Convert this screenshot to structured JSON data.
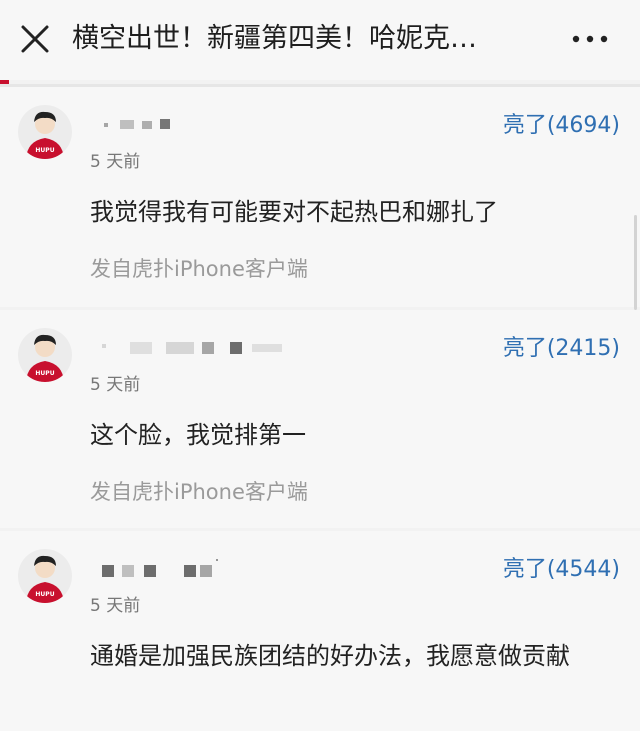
{
  "header": {
    "title": "横空出世！新疆第四美！哈妮克…",
    "close_icon": "close-icon",
    "more_icon": "more-icon",
    "accent_color": "#c8102e"
  },
  "comments": [
    {
      "avatar_text": "HUPU",
      "lights": "亮了(4694)",
      "time": "5 天前",
      "content": "我觉得我有可能要对不起热巴和娜扎了",
      "source": "发自虎扑iPhone客户端"
    },
    {
      "avatar_text": "HUPU",
      "lights": "亮了(2415)",
      "time": "5 天前",
      "content": "这个脸，我觉排第一",
      "source": "发自虎扑iPhone客户端"
    },
    {
      "avatar_text": "HUPU",
      "lights": "亮了(4544)",
      "time": "5 天前",
      "content": "通婚是加强民族团结的好办法，我愿意做贡献",
      "source": ""
    }
  ],
  "colors": {
    "light_link": "#2f6fb2",
    "avatar_shirt": "#c8102e"
  }
}
